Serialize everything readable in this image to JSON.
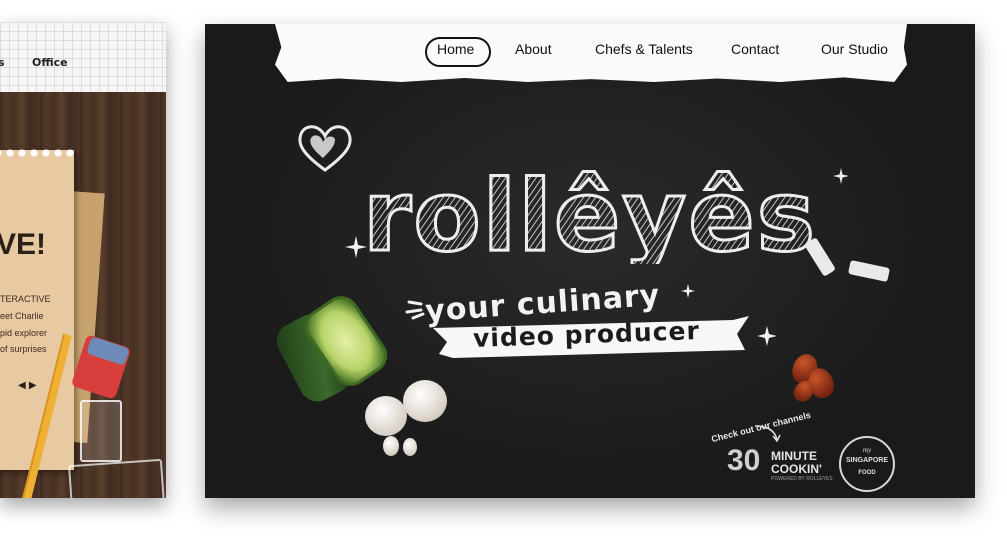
{
  "left_card": {
    "nav_items": [
      "s",
      "Office"
    ],
    "headline": "VE!",
    "lines": [
      "TERACTIVE",
      "eet Charlie",
      "pid explorer",
      "of surprises"
    ],
    "arrows": "◀ ▶"
  },
  "main_card": {
    "nav": {
      "items": [
        "Home",
        "About",
        "Chefs & Talents",
        "Contact",
        "Our Studio"
      ],
      "active": "Home"
    },
    "logo": "rollêyês",
    "tagline_line1": "your culinary",
    "tagline_line2": "video producer",
    "channels_label": "Check out our channels",
    "channel1": {
      "number": "30",
      "name": "MINUTE COOKIN'",
      "sub": "POWERED BY ROLLEYES"
    },
    "channel2": {
      "prefix": "my",
      "name": "SINGAPORE",
      "sub": "FOOD"
    }
  },
  "colors": {
    "chalkboard": "#1d1d1d",
    "chalk": "#eeeeee",
    "paper": "#fafafa",
    "wood": "#4a3528"
  },
  "icons": [
    "heart-icon",
    "sparkle-icon",
    "chalk-icon"
  ]
}
